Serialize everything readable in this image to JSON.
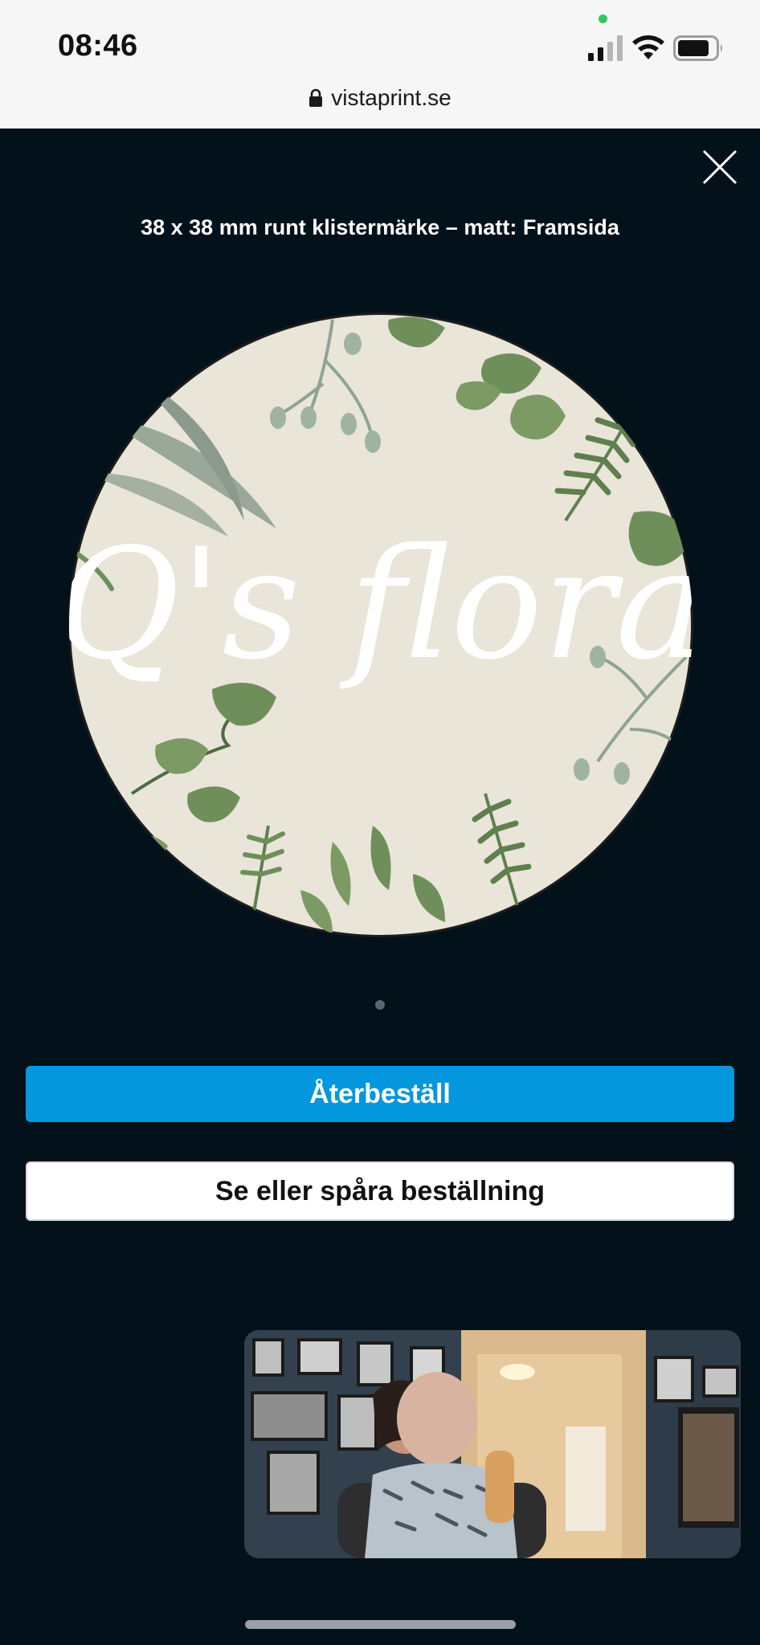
{
  "status_bar": {
    "time": "08:46"
  },
  "browser": {
    "url": "vistaprint.se"
  },
  "preview": {
    "title": "38 x 38 mm runt klistermärke – matt: Framsida",
    "sticker_text": "Q's flora",
    "page_index": 1,
    "page_count": 1
  },
  "actions": {
    "reorder_label": "Återbeställ",
    "track_order_label": "Se eller spåra beställning"
  },
  "colors": {
    "background": "#03111b",
    "primary_button": "#0597de",
    "sticker_paper": "#e9e5d9",
    "leaf_green": "#6f8f5a"
  },
  "icons": {
    "close": "close-icon",
    "lock": "lock-icon",
    "signal": "cellular-signal-icon",
    "wifi": "wifi-icon",
    "battery": "battery-icon"
  }
}
